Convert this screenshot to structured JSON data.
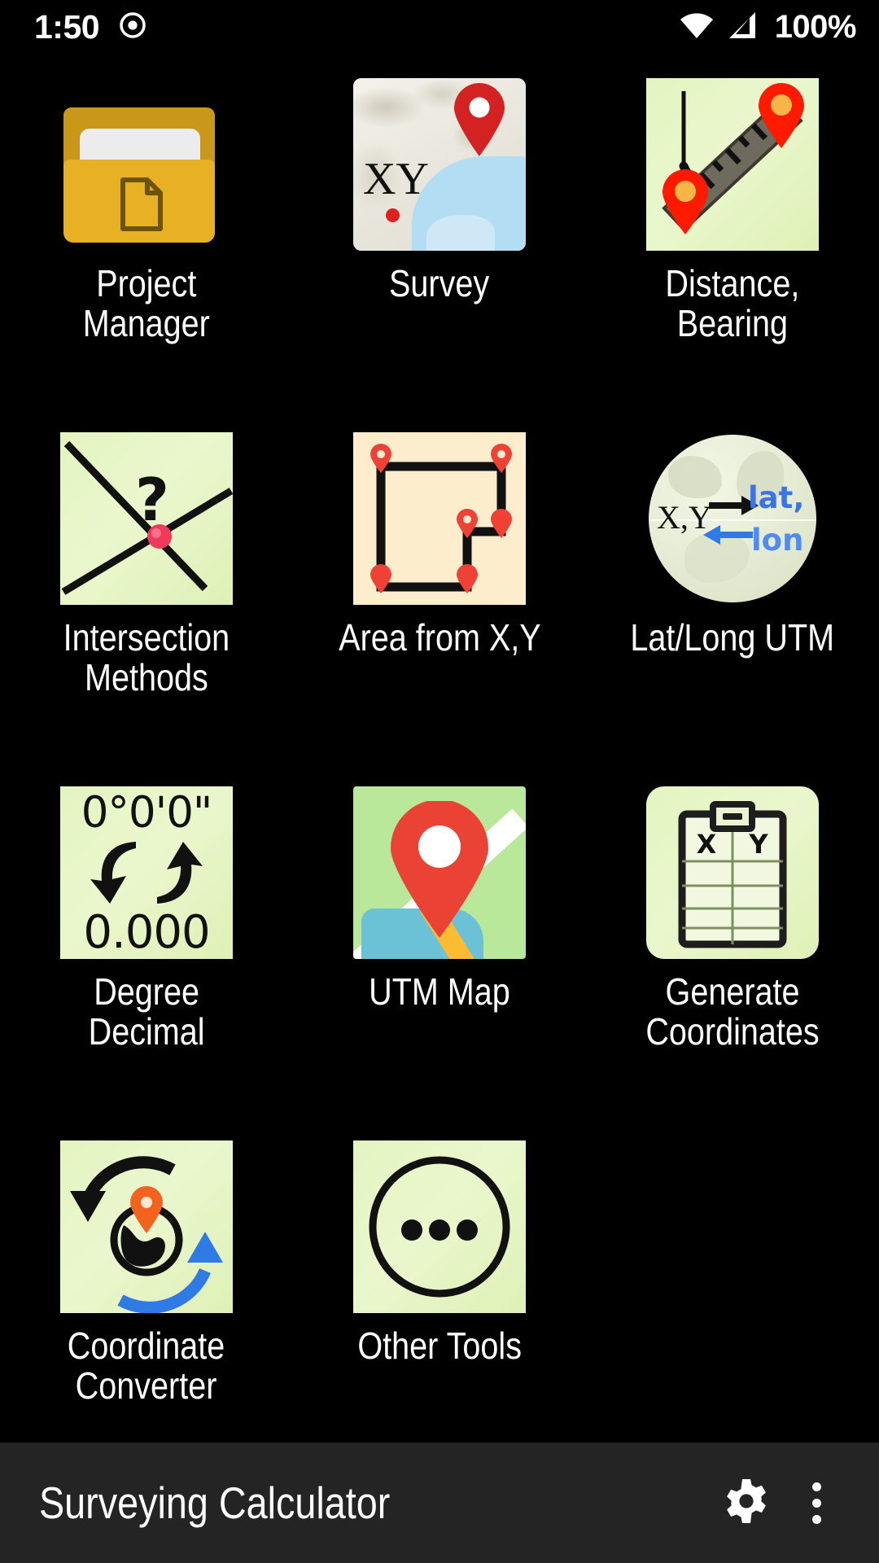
{
  "status_bar": {
    "time": "1:50",
    "left_icon": "record-circle-icon",
    "wifi_icon": "wifi-icon",
    "signal_icon": "cellular-signal-icon",
    "battery": "100%"
  },
  "app": {
    "title": "Surveying Calculator",
    "settings_icon": "gear-icon",
    "overflow_icon": "overflow-menu-icon",
    "bottom_bar_color": "#242424",
    "background_color": "#000000"
  },
  "grid": {
    "columns": 3,
    "items": [
      {
        "id": "project-manager",
        "label": "Project\nManager",
        "icon": "folder-document-icon",
        "colors": {
          "folder_back": "#c9981a",
          "folder_front": "#e8b025",
          "paper": "#ececec",
          "doc_outline": "#6b5410"
        }
      },
      {
        "id": "survey",
        "label": "Survey",
        "icon": "terrain-map-xy-pin-icon",
        "text_overlay": "XY",
        "colors": {
          "terrain": "#e8e6df",
          "water": "#b3ddf2",
          "pin": "#e31b1b"
        }
      },
      {
        "id": "distance-bearing",
        "label": "Distance,\nBearing",
        "icon": "ruler-bearing-angle-icon",
        "colors": {
          "background": "#e4f4c0",
          "ruler": "#6e6a5e",
          "pin": "#ff1a00",
          "pin_center": "#f7b548"
        }
      },
      {
        "id": "intersection-methods",
        "label": "Intersection\nMethods",
        "icon": "crossing-lines-question-icon",
        "text_overlay": "?",
        "colors": {
          "background": "#dff0b6",
          "lines": "#111111",
          "node": "#ef3a5c"
        }
      },
      {
        "id": "area-from-xy",
        "label": "Area from X,Y",
        "icon": "polygon-pins-area-icon",
        "colors": {
          "background": "#fcedcd",
          "outline": "#111111",
          "pin": "#f04136"
        }
      },
      {
        "id": "lat-long-utm",
        "label": "Lat/Long UTM",
        "icon": "globe-coordinate-conversion-icon",
        "text_left": "X,Y",
        "text_right_line1": "lat,",
        "text_right_line2": "lon",
        "colors": {
          "globe": "#e9eed9",
          "blue_text": "#3b74e8",
          "arrow_black": "#111111",
          "arrow_blue": "#2f7ae5"
        }
      },
      {
        "id": "degree-decimal",
        "label": "Degree\nDecimal",
        "icon": "dms-to-decimal-icon",
        "text_top": "0°0'0\"",
        "text_bottom": "0.000",
        "colors": {
          "background": "#e4f4c0",
          "text": "#111111"
        }
      },
      {
        "id": "utm-map",
        "label": "UTM Map",
        "icon": "map-pin-icon",
        "colors": {
          "land": "#b9e89a",
          "road_white": "#ffffff",
          "road_yellow": "#fbbc32",
          "water": "#6bc2d6",
          "pin": "#ea4335"
        }
      },
      {
        "id": "generate-coordinates",
        "label": "Generate\nCoordinates",
        "icon": "clipboard-table-icon",
        "column_headers": [
          "X",
          "Y"
        ],
        "colors": {
          "background": "#dff0b6",
          "clipboard": "#1d1d1d",
          "sheet": "#f2f8e0"
        }
      },
      {
        "id": "coordinate-converter",
        "label": "Coordinate\nConverter",
        "icon": "globe-refresh-arrows-icon",
        "colors": {
          "background": "#dff0b6",
          "arrow_black": "#111111",
          "arrow_blue": "#2f7ae5",
          "pin": "#f4631e"
        }
      },
      {
        "id": "other-tools",
        "label": "Other Tools",
        "icon": "ellipsis-circle-icon",
        "colors": {
          "background": "#e4f4c0",
          "circle": "#111111"
        }
      }
    ]
  }
}
